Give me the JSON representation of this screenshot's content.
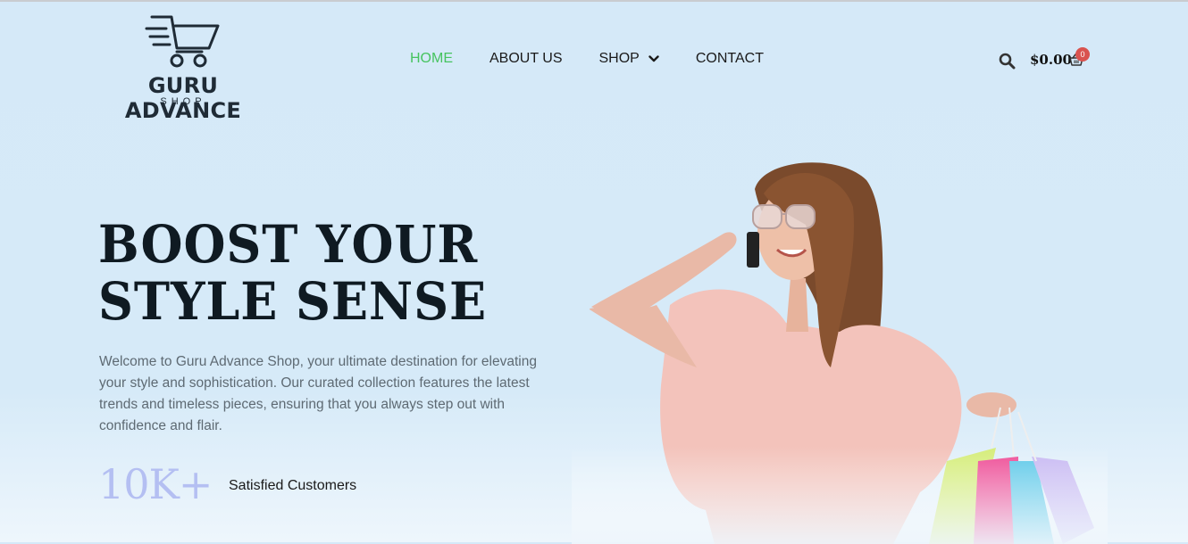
{
  "brand": {
    "name": "GURU ADVANCE",
    "sub": "SHOP"
  },
  "nav": {
    "items": [
      {
        "label": "HOME",
        "active": true
      },
      {
        "label": "ABOUT US"
      },
      {
        "label": "SHOP",
        "has_dropdown": true
      },
      {
        "label": "CONTACT"
      }
    ]
  },
  "header": {
    "cart_total": "$0.00",
    "cart_count": "0",
    "icons": [
      "search-icon",
      "basket-icon"
    ]
  },
  "hero": {
    "title_line1": "BOOST YOUR",
    "title_line2": "STYLE SENSE",
    "description": "Welcome to Guru Advance Shop, your ultimate destination for elevating your style and sophistication. Our curated collection features the latest trends and timeless pieces, ensuring that you always step out with confidence and flair.",
    "stat_value": "10K+",
    "stat_label": "Satisfied Customers"
  },
  "colors": {
    "accent": "#46c35f",
    "badge": "#d9534f",
    "stat": "#b4bff2",
    "background": "#d5e9f8"
  }
}
